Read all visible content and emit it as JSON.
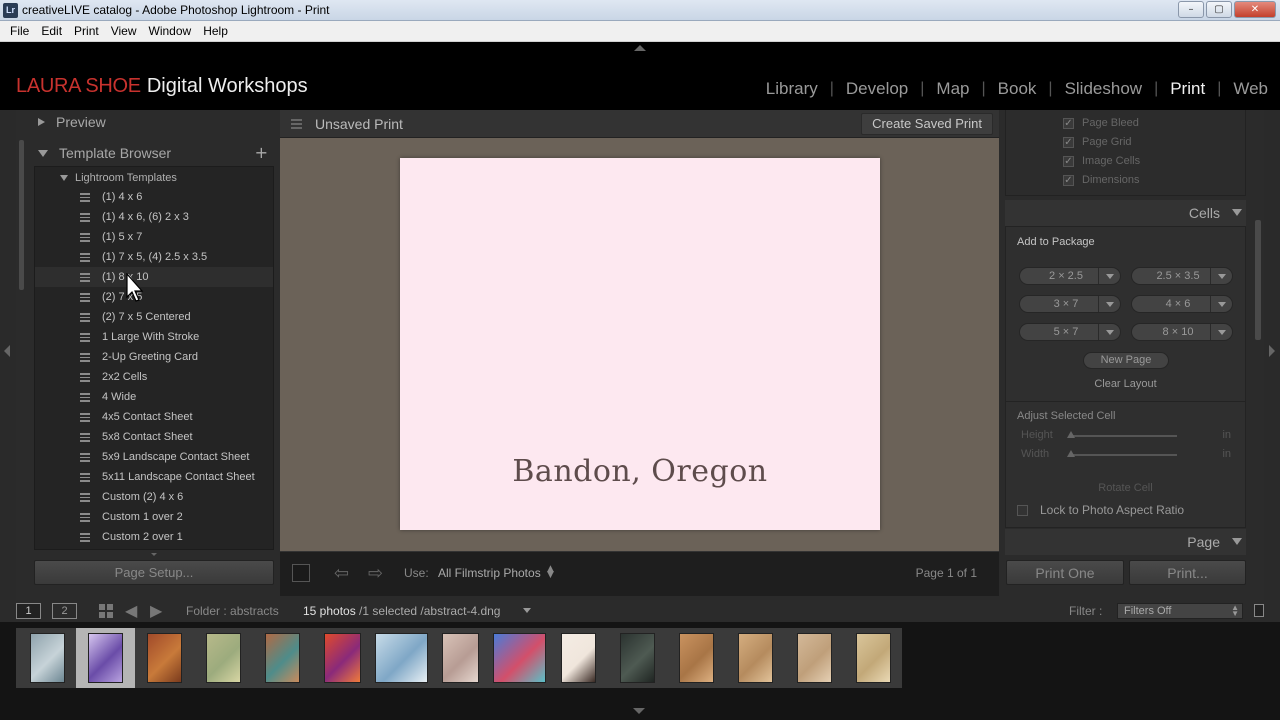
{
  "window": {
    "title": "creativeLIVE catalog - Adobe Photoshop Lightroom - Print",
    "app_icon": "Lr",
    "buttons": {
      "minimize": "–",
      "maximize": "▢",
      "close": "✕"
    }
  },
  "menu": [
    "File",
    "Edit",
    "Print",
    "View",
    "Window",
    "Help"
  ],
  "identity_plate": {
    "first": "LAURA SHOE",
    "second": "Digital Workshops",
    "accent_color": "#c8322e"
  },
  "modules": {
    "items": [
      "Library",
      "Develop",
      "Map",
      "Book",
      "Slideshow",
      "Print",
      "Web"
    ],
    "active": "Print"
  },
  "left_panel": {
    "preview_label": "Preview",
    "template_browser_label": "Template Browser",
    "add_icon": "+",
    "folder_label": "Lightroom Templates",
    "templates": [
      "(1) 4 x 6",
      "(1) 4 x 6, (6) 2 x 3",
      "(1) 5 x 7",
      "(1) 7 x 5, (4) 2.5 x 3.5",
      "(1) 8 x 10",
      "(2) 7 x 5",
      "(2) 7 x 5 Centered",
      "1 Large With Stroke",
      "2-Up Greeting Card",
      "2x2 Cells",
      "4 Wide",
      "4x5 Contact Sheet",
      "5x8 Contact Sheet",
      "5x9 Landscape Contact Sheet",
      "5x11 Landscape Contact Sheet",
      "Custom (2) 4 x 6",
      "Custom 1 over 2",
      "Custom 2 over 1"
    ],
    "hovered_index": 4,
    "page_setup_label": "Page Setup..."
  },
  "center": {
    "title": "Unsaved Print",
    "create_saved_print_label": "Create Saved Print",
    "page_caption": "Bandon, Oregon",
    "page_color": "#fde8f0",
    "canvas_color": "#6b6258"
  },
  "toolbar": {
    "use_label": "Use:",
    "use_value": "All Filmstrip Photos",
    "page_indicator": "Page 1 of 1"
  },
  "right_panel": {
    "guides": [
      "Page Bleed",
      "Page Grid",
      "Image Cells",
      "Dimensions"
    ],
    "cells_label": "Cells",
    "add_to_package_label": "Add to Package",
    "sizes": [
      "2 × 2.5",
      "2.5 × 3.5",
      "3 × 7",
      "4 × 6",
      "5 × 7",
      "8 × 10"
    ],
    "new_page_label": "New Page",
    "clear_layout_label": "Clear Layout",
    "adjust_selected_cell_label": "Adjust Selected Cell",
    "height_label": "Height",
    "width_label": "Width",
    "unit": "in",
    "rotate_cell_label": "Rotate Cell",
    "lock_aspect_label": "Lock to Photo Aspect Ratio",
    "page_label": "Page",
    "print_one_label": "Print One",
    "print_label": "Print..."
  },
  "filmstrip_bar": {
    "screen1": "1",
    "screen2": "2",
    "folder_text": "Folder : abstracts",
    "photo_count": "15 photos",
    "selection_text": " /1 selected /abstract-4.dng",
    "filter_label": "Filter :",
    "filter_value": "Filters Off"
  },
  "thumbnails": [
    {
      "colors": [
        "#8fa3ad",
        "#c7d3d8",
        "#6d8793"
      ],
      "selected": false
    },
    {
      "colors": [
        "#d6c6ef",
        "#6a4ca8",
        "#b9a3e0"
      ],
      "selected": true
    },
    {
      "colors": [
        "#a14a2a",
        "#c87a3a",
        "#7b3b1d"
      ],
      "selected": false
    },
    {
      "colors": [
        "#b7b98a",
        "#9cab7d",
        "#d8d6a4"
      ],
      "selected": false
    },
    {
      "colors": [
        "#b06a45",
        "#4e8c8a",
        "#c98b5c"
      ],
      "selected": false
    },
    {
      "colors": [
        "#e04a2c",
        "#8a2a7a",
        "#f07b3a"
      ],
      "selected": false
    },
    {
      "colors": [
        "#c7dbe8",
        "#7fa7c6",
        "#e8f0f4"
      ],
      "selected": false
    },
    {
      "colors": [
        "#d8c2b7",
        "#b79c94",
        "#e6d7cf"
      ],
      "selected": false
    },
    {
      "colors": [
        "#4a7bd8",
        "#d34f6a",
        "#5ac0c8"
      ],
      "selected": false
    },
    {
      "colors": [
        "#f4ece4",
        "#f0e6dc",
        "#3a2a24"
      ],
      "selected": false
    },
    {
      "colors": [
        "#2b3330",
        "#4e5a52",
        "#1f2522"
      ],
      "selected": false
    },
    {
      "colors": [
        "#c9925f",
        "#a87546",
        "#ddb081"
      ],
      "selected": false
    },
    {
      "colors": [
        "#d4ad7f",
        "#b58b5e",
        "#e2c39a"
      ],
      "selected": false
    },
    {
      "colors": [
        "#d3b898",
        "#bf9f7a",
        "#e5d0b4"
      ],
      "selected": false
    },
    {
      "colors": [
        "#d9c59a",
        "#c2a878",
        "#ead9b5"
      ],
      "selected": false
    }
  ]
}
